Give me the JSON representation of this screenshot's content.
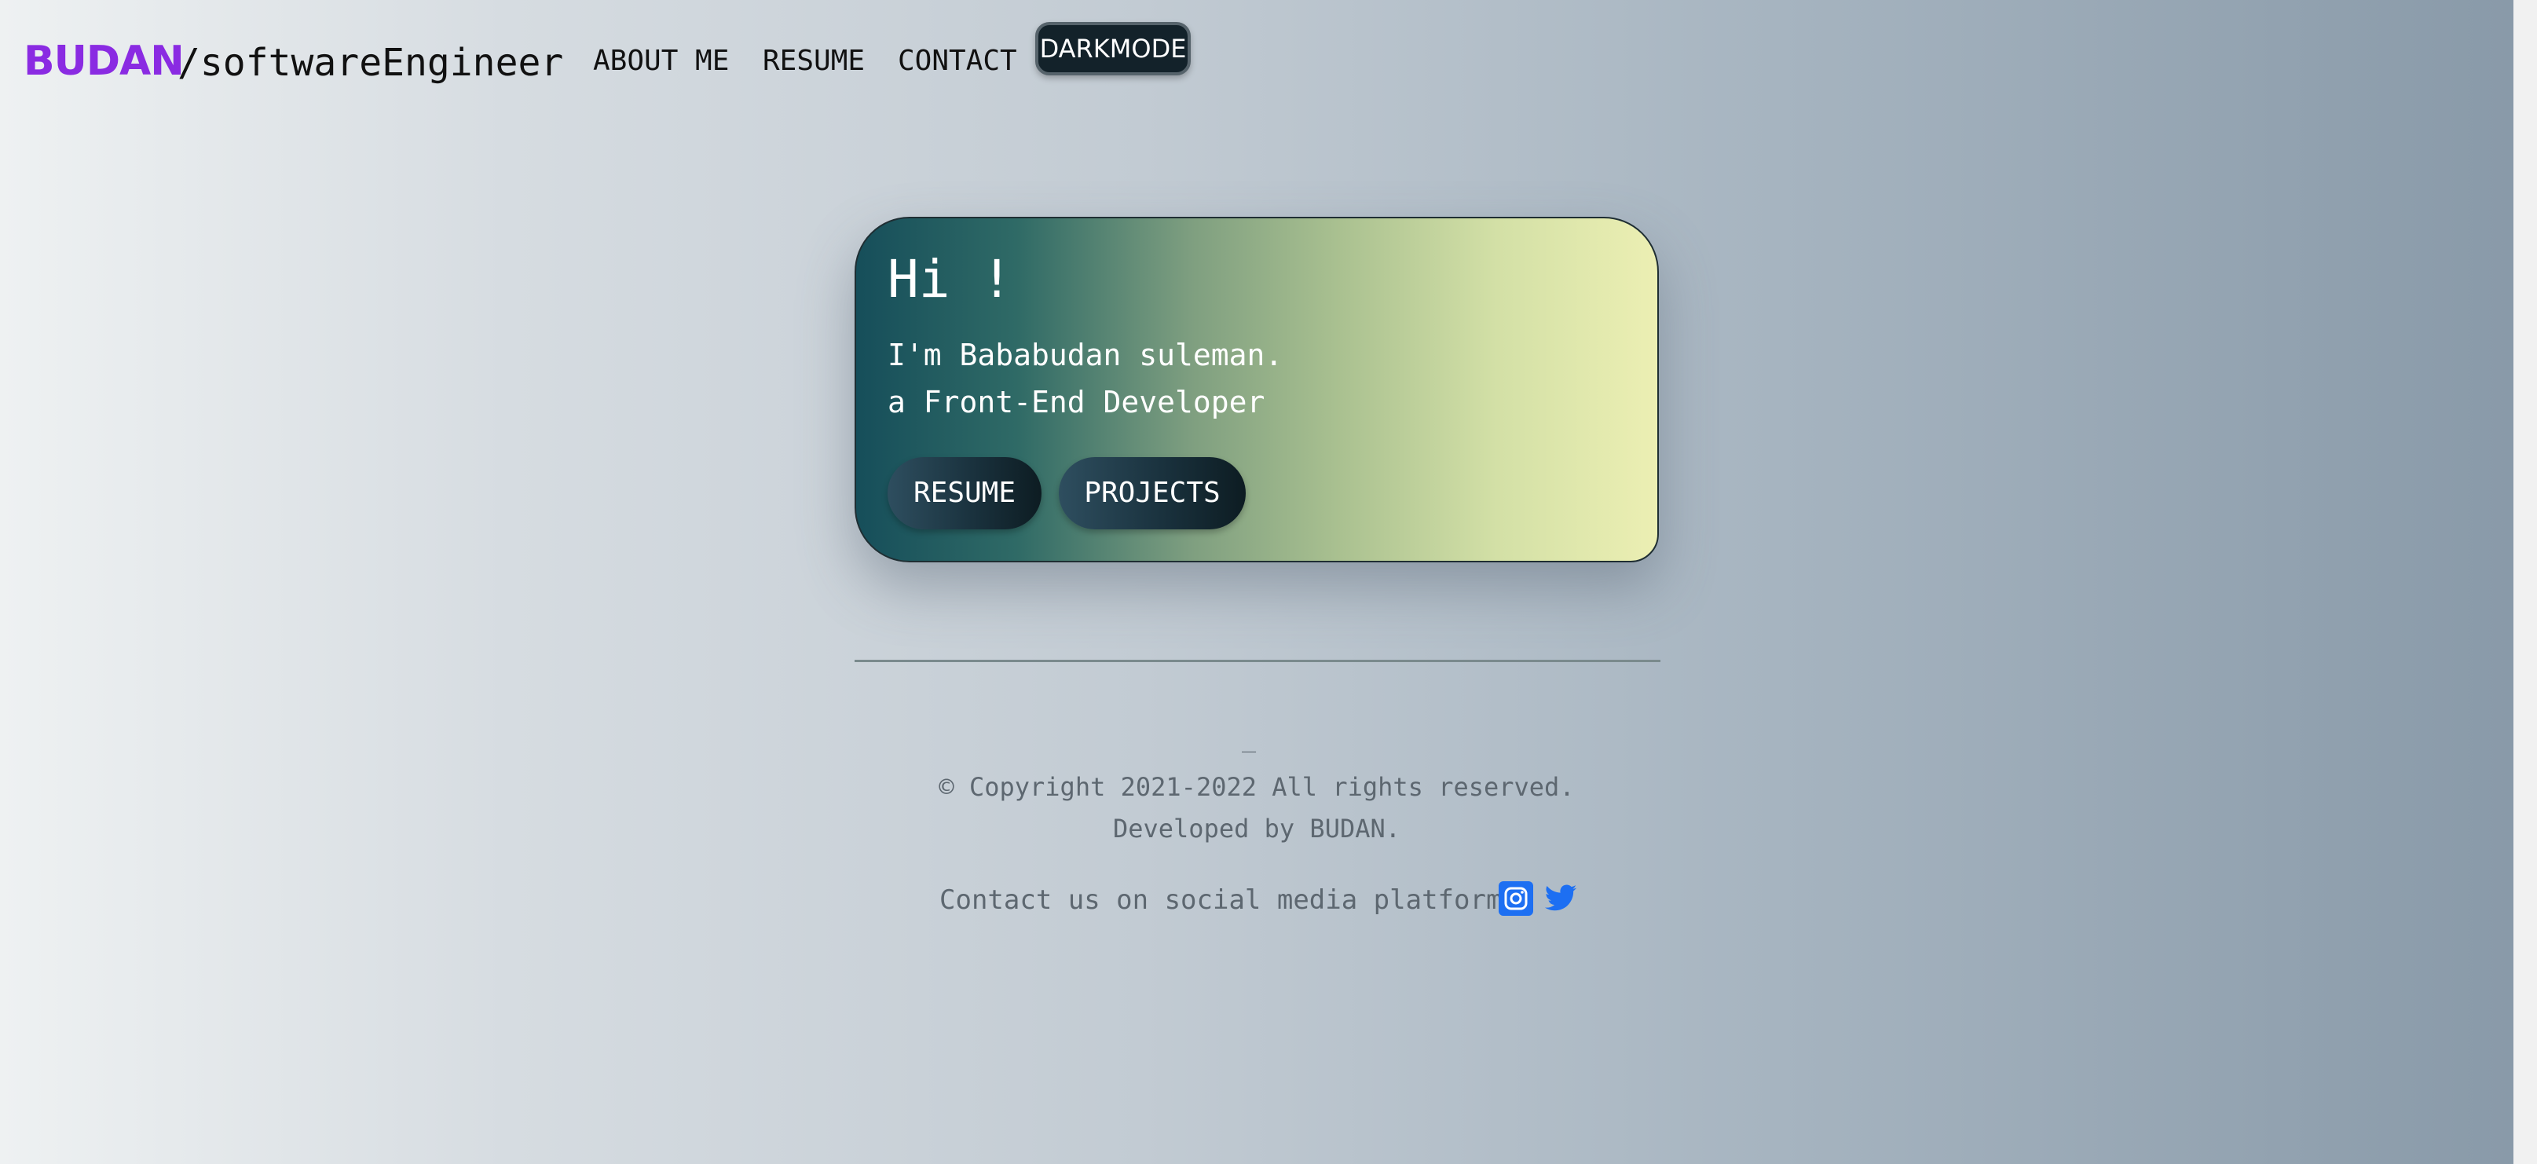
{
  "header": {
    "brand": "BUDAN",
    "role": "/softwareEngineer",
    "nav": {
      "about": "ABOUT ME",
      "resume": "RESUME",
      "contact": "CONTACT"
    },
    "darkmode_label": "DARKMODE"
  },
  "hero": {
    "greeting": "Hi !",
    "line1": "I'm Bababudan suleman.",
    "line2": "a Front-End Developer",
    "buttons": {
      "resume": "RESUME",
      "projects": "PROJECTS"
    }
  },
  "footer": {
    "dash": "_",
    "copyright": "© Copyright 2021-2022 All rights reserved.",
    "developed_by": "Developed by BUDAN.",
    "social_text": "Contact us on social media platforms",
    "icons": [
      "instagram-icon",
      "twitter-icon"
    ]
  },
  "colors": {
    "brand": "#8a2be2",
    "social_icon": "#1d6ff2",
    "card_start": "#164e5a",
    "card_end": "#ecefb3"
  }
}
